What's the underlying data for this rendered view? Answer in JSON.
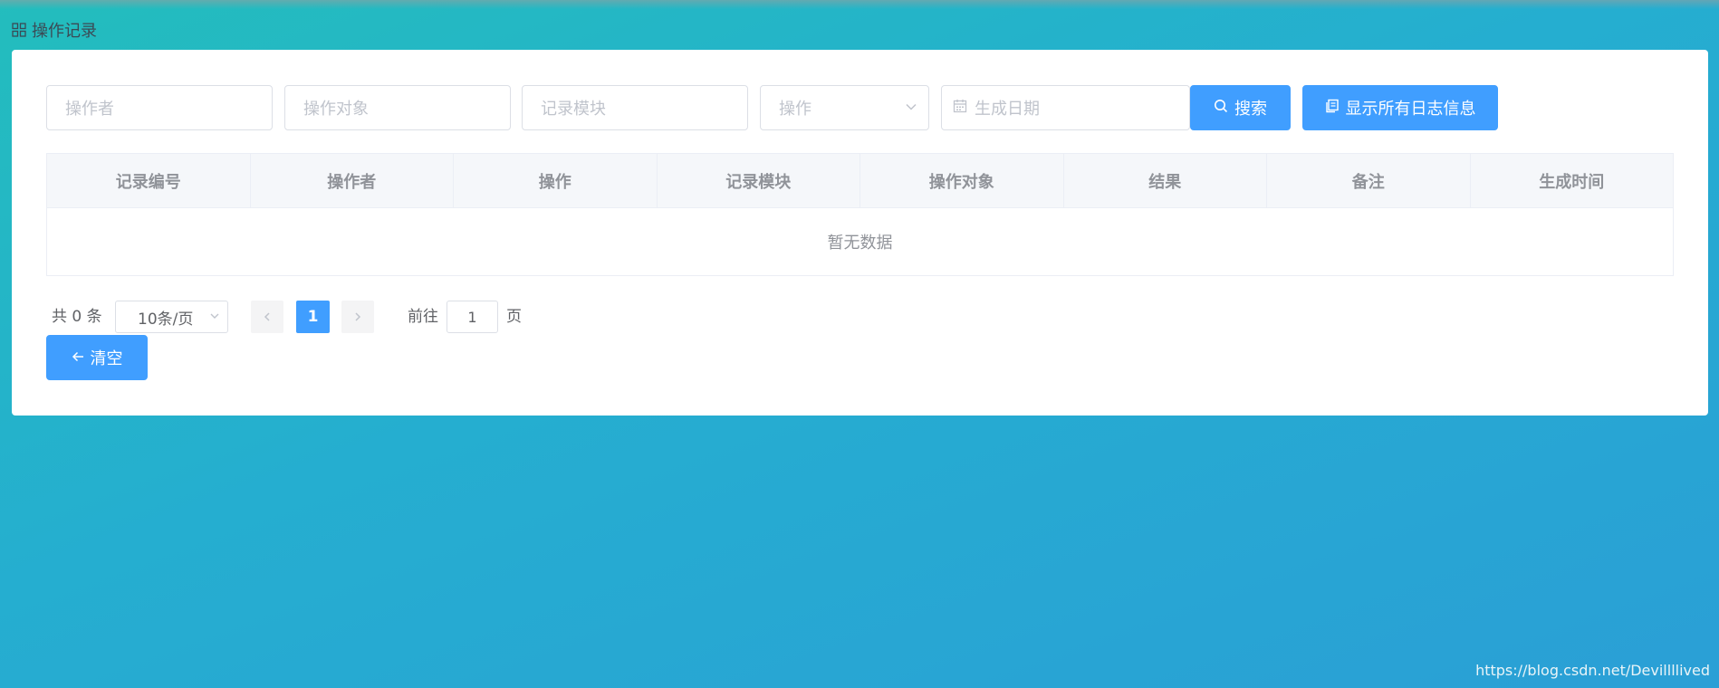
{
  "header": {
    "title": "操作记录"
  },
  "filters": {
    "operator_placeholder": "操作者",
    "target_placeholder": "操作对象",
    "module_placeholder": "记录模块",
    "operation_placeholder": "操作",
    "date_placeholder": "生成日期"
  },
  "buttons": {
    "search": "搜索",
    "show_all": "显示所有日志信息",
    "clear": "清空"
  },
  "table": {
    "columns": [
      "记录编号",
      "操作者",
      "操作",
      "记录模块",
      "操作对象",
      "结果",
      "备注",
      "生成时间"
    ],
    "empty_text": "暂无数据"
  },
  "pagination": {
    "total": "共 0 条",
    "page_size": "10条/页",
    "current_page": "1",
    "goto_label": "前往",
    "goto_value": "1",
    "page_suffix": "页"
  },
  "watermark": "https://blog.csdn.net/Devillllived",
  "colors": {
    "primary": "#409eff",
    "border": "#dcdfe6",
    "header_bg": "#f5f7fa"
  }
}
